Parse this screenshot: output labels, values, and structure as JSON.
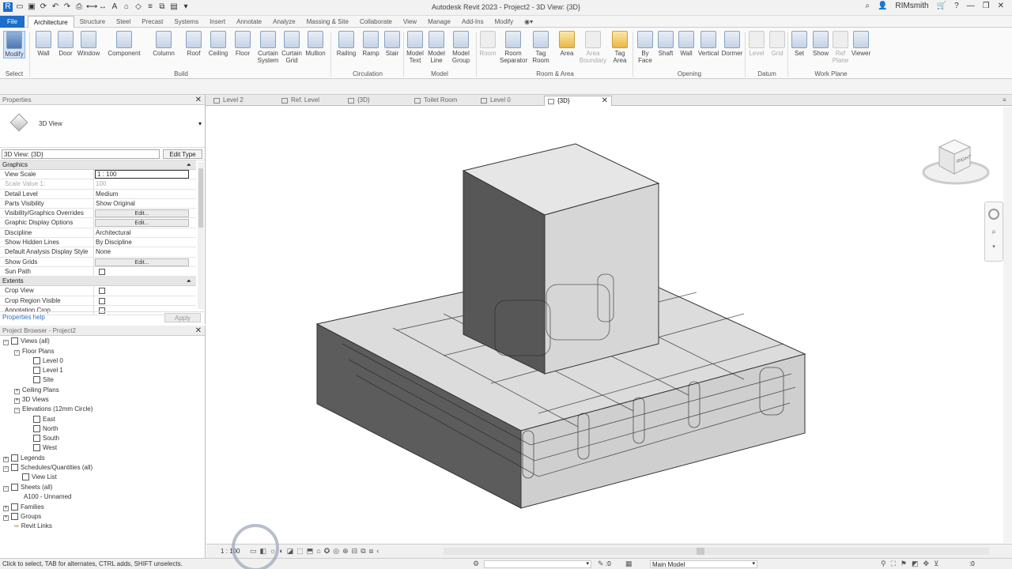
{
  "app": {
    "title": "Autodesk Revit 2023 - Project2 - 3D View: {3D}",
    "user": "RIMsmith"
  },
  "tabs": [
    "File",
    "Architecture",
    "Structure",
    "Steel",
    "Precast",
    "Systems",
    "Insert",
    "Annotate",
    "Analyze",
    "Massing & Site",
    "Collaborate",
    "View",
    "Manage",
    "Add-Ins",
    "Modify"
  ],
  "ribbon": {
    "buttons": [
      "Modify",
      "Wall",
      "Door",
      "Window",
      "Component",
      "Column",
      "Roof",
      "Ceiling",
      "Floor",
      "Curtain System",
      "Curtain Grid",
      "Mullion",
      "Railing",
      "Ramp",
      "Stair",
      "Model Text",
      "Model Line",
      "Model Group",
      "Room",
      "Room Separator",
      "Tag Room",
      "Area",
      "Area Boundary",
      "Tag Area",
      "By Face",
      "Shaft",
      "Wall",
      "Vertical",
      "Dormer",
      "Level",
      "Grid",
      "Set",
      "Show",
      "Ref Plane",
      "Viewer"
    ],
    "panels": [
      "Select",
      "Build",
      "Circulation",
      "Model",
      "Room & Area",
      "Opening",
      "Datum",
      "Work Plane"
    ]
  },
  "properties": {
    "title": "Properties",
    "type_name": "3D View",
    "instance": "3D View: {3D}",
    "edit_type": "Edit Type",
    "sections": {
      "graphics": "Graphics",
      "extents": "Extents"
    },
    "rows": [
      {
        "k": "View Scale",
        "v": "1 : 100"
      },
      {
        "k": "Scale Value 1:",
        "v": "100"
      },
      {
        "k": "Detail Level",
        "v": "Medium"
      },
      {
        "k": "Parts Visibility",
        "v": "Show Original"
      },
      {
        "k": "Visibility/Graphics Overrides",
        "v": "Edit..."
      },
      {
        "k": "Graphic Display Options",
        "v": "Edit..."
      },
      {
        "k": "Discipline",
        "v": "Architectural"
      },
      {
        "k": "Show Hidden Lines",
        "v": "By Discipline"
      },
      {
        "k": "Default Analysis Display Style",
        "v": "None"
      },
      {
        "k": "Show Grids",
        "v": "Edit..."
      },
      {
        "k": "Sun Path",
        "v": ""
      }
    ],
    "extents_rows": [
      {
        "k": "Crop View",
        "v": ""
      },
      {
        "k": "Crop Region Visible",
        "v": ""
      },
      {
        "k": "Annotation Crop",
        "v": ""
      }
    ],
    "help": "Properties help",
    "apply": "Apply"
  },
  "browser": {
    "title": "Project Browser - Project2",
    "nodes": [
      "Views (all)",
      "Floor Plans",
      "Level 0",
      "Level 1",
      "Site",
      "Ceiling Plans",
      "3D Views",
      "Elevations (12mm Circle)",
      "East",
      "North",
      "South",
      "West",
      "Legends",
      "Schedules/Quantities (all)",
      "View List",
      "Sheets (all)",
      "A100 - Unnamed",
      "Families",
      "Groups",
      "Revit Links"
    ]
  },
  "view_tabs": [
    "Level 2",
    "Ref. Level",
    "{3D}",
    "Toilet Room",
    "Level 0",
    "{3D}"
  ],
  "view_control": {
    "scale": "1 : 100"
  },
  "status": {
    "text": "Click to select, TAB for alternates, CTRL adds, SHIFT unselects.",
    "counter": ":0",
    "model": "Main Model",
    "filter": ":0"
  },
  "viewcube": {
    "label": "RIGHT"
  }
}
